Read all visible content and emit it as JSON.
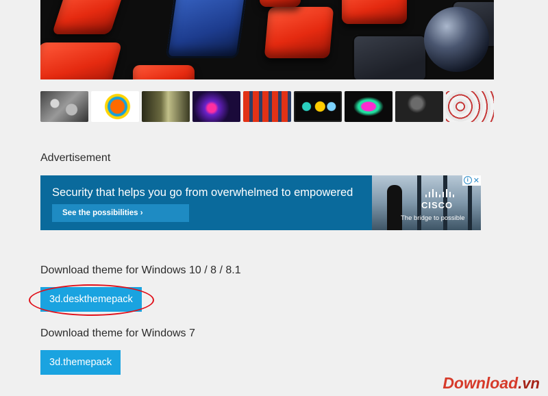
{
  "hero": {
    "alt": "3D cubes theme preview"
  },
  "thumbnails": [
    "t1",
    "t2",
    "t3",
    "t4",
    "t5",
    "t6",
    "t7",
    "t8",
    "t9",
    "t10"
  ],
  "advertisement": {
    "label": "Advertisement",
    "headline": "Security that helps you go from overwhelmed to empowered",
    "cta": "See the possibilities ›",
    "brand": "CISCO",
    "tagline": "The bridge to possible",
    "info_icon": "i",
    "close_icon": "✕"
  },
  "download_win10": {
    "label": "Download theme for Windows 10 / 8 / 8.1",
    "button": "3d.deskthemepack"
  },
  "download_win7": {
    "label": "Download theme for Windows 7",
    "button": "3d.themepack"
  },
  "watermark": {
    "main": "Download",
    "suffix": ".vn"
  },
  "colors": {
    "button": "#1aa3e0",
    "highlight": "#e0101a",
    "ad_bg": "#0a6a9c"
  }
}
